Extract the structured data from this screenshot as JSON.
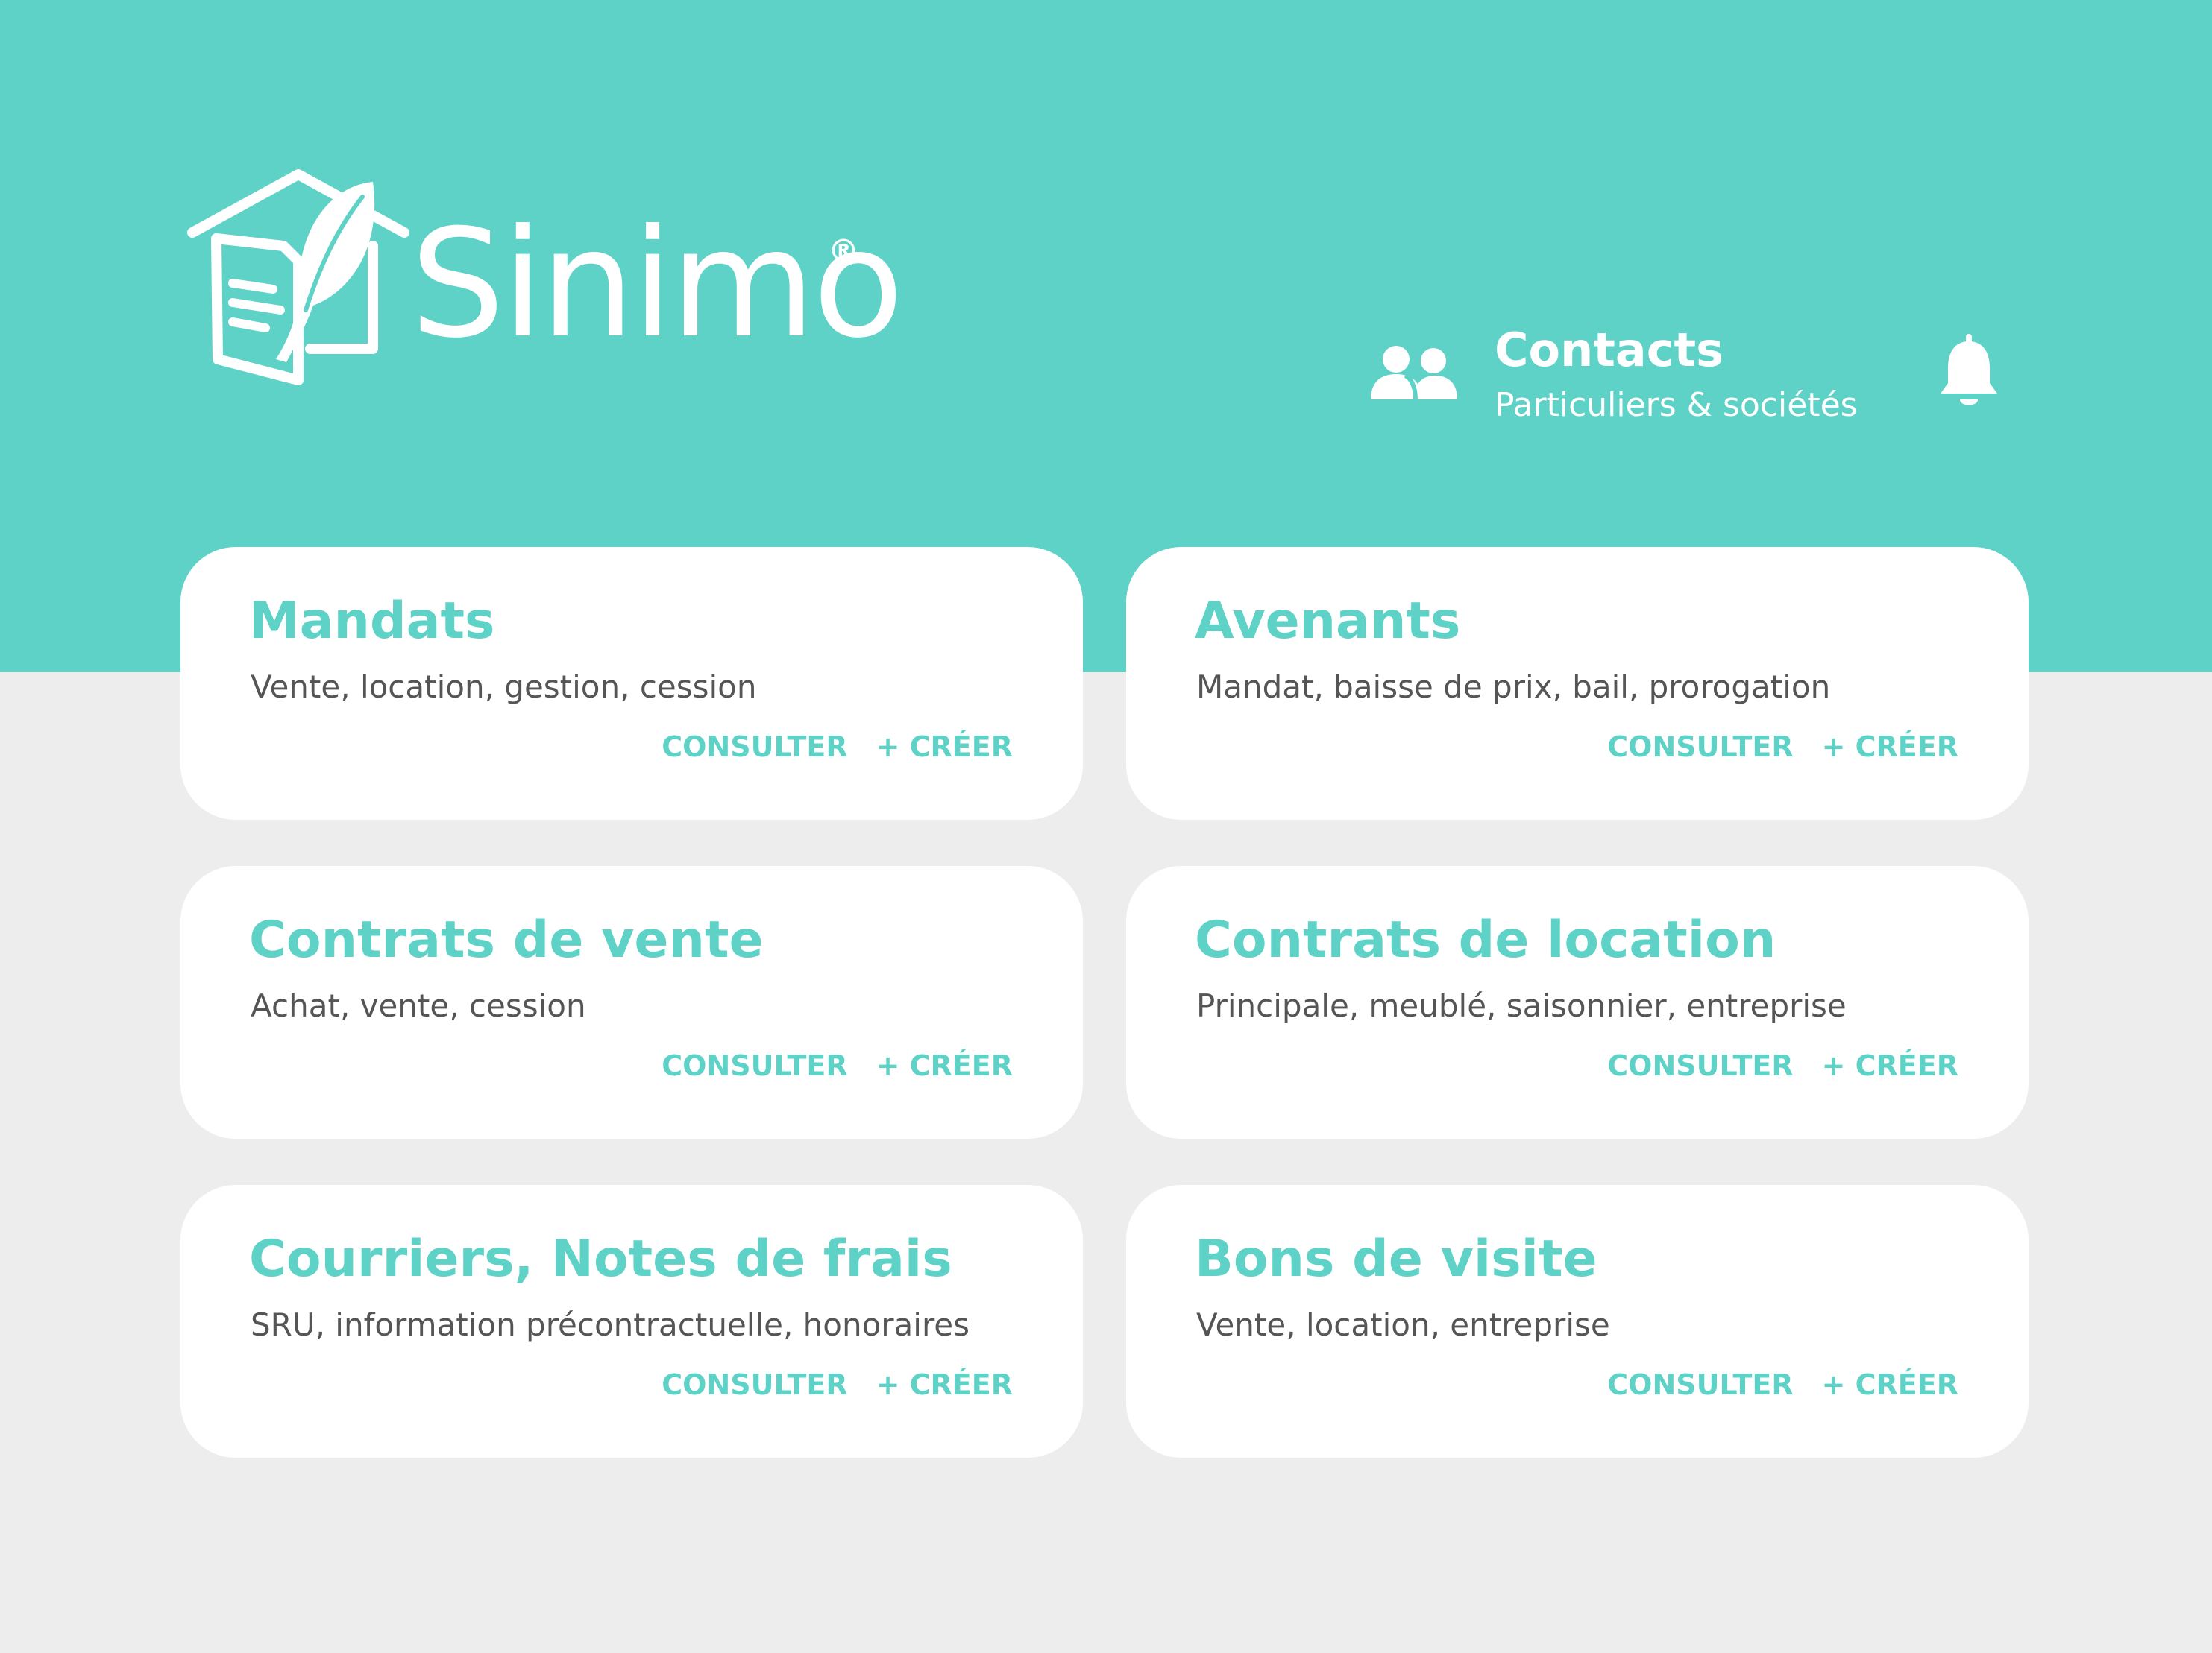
{
  "brand": {
    "name": "Sinimo",
    "registered_mark": "®",
    "primary_color": "#5ED2C6",
    "background_color": "#EDEDED",
    "card_color": "#FFFFFF",
    "text_color": "#555555",
    "logo_icon": "house-feather-document-icon"
  },
  "header": {
    "contacts": {
      "icon": "users-icon",
      "title": "Contacts",
      "subtitle": "Particuliers & sociétés"
    },
    "notifications_icon": "bell-icon"
  },
  "cards": [
    {
      "id": "mandats",
      "title": "Mandats",
      "description": "Vente, location, gestion, cession",
      "consult_label": "CONSULTER",
      "create_label": "+ CRÉER"
    },
    {
      "id": "avenants",
      "title": "Avenants",
      "description": "Mandat, baisse de prix, bail, prorogation",
      "consult_label": "CONSULTER",
      "create_label": "+ CRÉER"
    },
    {
      "id": "contrats-vente",
      "title": "Contrats de vente",
      "description": "Achat, vente, cession",
      "consult_label": "CONSULTER",
      "create_label": "+ CRÉER"
    },
    {
      "id": "contrats-location",
      "title": "Contrats de location",
      "description": "Principale, meublé, saisonnier, entreprise",
      "consult_label": "CONSULTER",
      "create_label": "+ CRÉER"
    },
    {
      "id": "courriers",
      "title": "Courriers, Notes de frais",
      "description": "SRU, information précontractuelle, honoraires",
      "consult_label": "CONSULTER",
      "create_label": "+ CRÉER"
    },
    {
      "id": "bons-visite",
      "title": "Bons de visite",
      "description": "Vente, location, entreprise",
      "consult_label": "CONSULTER",
      "create_label": "+ CRÉER"
    }
  ]
}
